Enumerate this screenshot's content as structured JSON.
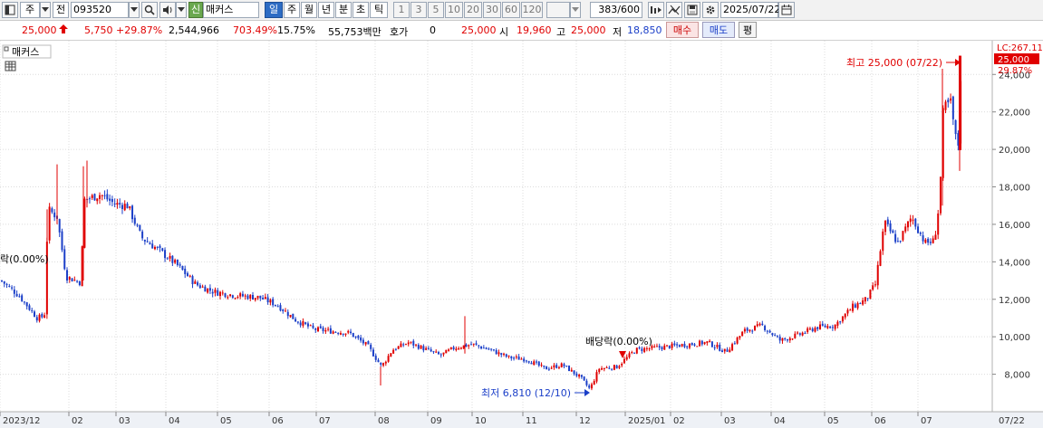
{
  "toolbar": {
    "market_label": "주",
    "prev_label": "전",
    "code": "093520",
    "new_badge": "신",
    "name": "매커스",
    "periods": [
      "일",
      "주",
      "월",
      "년",
      "분",
      "초",
      "틱"
    ],
    "selected_period": "일",
    "intervals": [
      "1",
      "3",
      "5",
      "10",
      "20",
      "30",
      "60",
      "120"
    ],
    "count": "383",
    "count_max": "/600",
    "date": "2025/07/22",
    "icons": [
      "window-icon",
      "dropdown-arrow-icon",
      "search-icon",
      "speaker-icon",
      "chart-tools-icon",
      "chart-type-icon",
      "save-icon",
      "gear-icon",
      "calendar-icon"
    ]
  },
  "quote": {
    "price": "25,000",
    "change": "5,750",
    "change_pct": "+29.87%",
    "volume": "2,544,966",
    "volume_ratio": "703.49%",
    "turnover": "15.75%",
    "amount": "55,753백만",
    "hoga_label": "호가",
    "hoga_value": "0",
    "hoga_price": "25,000",
    "open_label": "시",
    "open": "19,960",
    "high_label": "고",
    "high": "25,000",
    "low_label": "저",
    "low": "18,850",
    "buy_label": "매수",
    "sell_label": "매도",
    "avg_label": "평",
    "up_color": "#e00000",
    "down_color": "#1b3fc8"
  },
  "chart": {
    "panel_title": "매커스",
    "lc_label": "LC:267.11",
    "last_price_label": "25,000",
    "last_change_label": "29.87%",
    "high_annotation": "최고 25,000 (07/22)",
    "low_annotation": "최저 6,810 (12/10)",
    "dividend_annotation": "배당락(0.00%)",
    "left_annotation": "락(0.00%)",
    "bottom_right_label": "07/22"
  },
  "chart_data": {
    "type": "candlestick",
    "ylim": [
      6000,
      25800
    ],
    "yticks": [
      "8,000",
      "10,000",
      "12,000",
      "14,000",
      "16,000",
      "18,000",
      "20,000",
      "22,000",
      "24,000"
    ],
    "ytick_values": [
      8000,
      10000,
      12000,
      14000,
      16000,
      18000,
      20000,
      22000,
      24000
    ],
    "xtick_labels": [
      "2023/12",
      "02",
      "03",
      "04",
      "05",
      "06",
      "07",
      "08",
      "09",
      "10",
      "11",
      "12",
      "2025/01",
      "02",
      "03",
      "04",
      "05",
      "06",
      "07"
    ],
    "grid": true,
    "up_color": "#e00000",
    "down_color": "#1b3fc8",
    "price_path": [
      [
        0,
        13000
      ],
      [
        20,
        12200
      ],
      [
        40,
        11000
      ],
      [
        48,
        11100
      ],
      [
        52,
        16800
      ],
      [
        62,
        16400
      ],
      [
        72,
        13200
      ],
      [
        88,
        12900
      ],
      [
        92,
        17300
      ],
      [
        110,
        17600
      ],
      [
        125,
        17100
      ],
      [
        140,
        17000
      ],
      [
        155,
        15300
      ],
      [
        175,
        14600
      ],
      [
        195,
        13800
      ],
      [
        215,
        12800
      ],
      [
        235,
        12400
      ],
      [
        260,
        12200
      ],
      [
        285,
        12100
      ],
      [
        305,
        11700
      ],
      [
        325,
        10900
      ],
      [
        345,
        10400
      ],
      [
        365,
        10300
      ],
      [
        385,
        10200
      ],
      [
        405,
        9500
      ],
      [
        420,
        8400
      ],
      [
        432,
        9300
      ],
      [
        450,
        9700
      ],
      [
        470,
        9300
      ],
      [
        485,
        9000
      ],
      [
        500,
        9400
      ],
      [
        520,
        9600
      ],
      [
        540,
        9300
      ],
      [
        560,
        8900
      ],
      [
        580,
        8800
      ],
      [
        600,
        8300
      ],
      [
        620,
        8500
      ],
      [
        640,
        7800
      ],
      [
        650,
        7200
      ],
      [
        660,
        8300
      ],
      [
        680,
        8400
      ],
      [
        700,
        9300
      ],
      [
        720,
        9400
      ],
      [
        740,
        9500
      ],
      [
        760,
        9600
      ],
      [
        780,
        9700
      ],
      [
        800,
        9200
      ],
      [
        820,
        10300
      ],
      [
        840,
        10600
      ],
      [
        860,
        9800
      ],
      [
        880,
        10100
      ],
      [
        900,
        10500
      ],
      [
        920,
        10600
      ],
      [
        940,
        11600
      ],
      [
        955,
        12000
      ],
      [
        965,
        12800
      ],
      [
        975,
        16100
      ],
      [
        990,
        15000
      ],
      [
        1005,
        16400
      ],
      [
        1020,
        15000
      ],
      [
        1030,
        15100
      ],
      [
        1036,
        17300
      ],
      [
        1040,
        22200
      ],
      [
        1048,
        22500
      ],
      [
        1056,
        19800
      ],
      [
        1060,
        25000
      ]
    ]
  }
}
